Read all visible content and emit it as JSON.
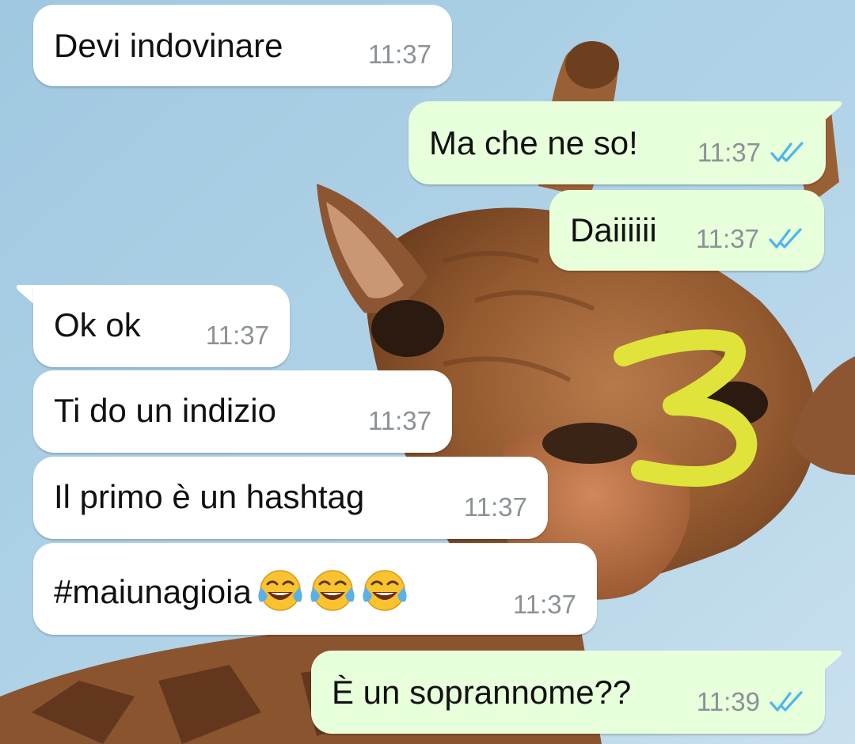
{
  "chat": {
    "messages": [
      {
        "direction": "incoming",
        "text": "Devi indovinare",
        "time": "11:37"
      },
      {
        "direction": "outgoing",
        "text": "Ma che ne so!",
        "time": "11:37",
        "status": "read"
      },
      {
        "direction": "outgoing",
        "text": "Daiiiiii",
        "time": "11:37",
        "status": "read"
      },
      {
        "direction": "incoming",
        "text": "Ok ok",
        "time": "11:37"
      },
      {
        "direction": "incoming",
        "text": "Ti do un indizio",
        "time": "11:37"
      },
      {
        "direction": "incoming",
        "text": "Il primo è un hashtag",
        "time": "11:37"
      },
      {
        "direction": "incoming",
        "text": "#maiunagioia",
        "emoji": [
          "😂",
          "😂",
          "😂"
        ],
        "emoji_icon": "face-with-tears-of-joy-icon",
        "time": "11:37"
      },
      {
        "direction": "outgoing",
        "text": "È un soprannome??",
        "time": "11:39",
        "status": "read"
      }
    ]
  },
  "overlay": {
    "annotation": "3",
    "color": "#dfe33a"
  },
  "colors": {
    "incoming_bubble": "#ffffff",
    "outgoing_bubble": "#e7ffdb",
    "timestamp": "#8b9296",
    "read_ticks": "#4fb6ec",
    "sky": "#a9cde3"
  },
  "wallpaper": {
    "subject_icon": "giraffe-wallpaper-icon"
  }
}
